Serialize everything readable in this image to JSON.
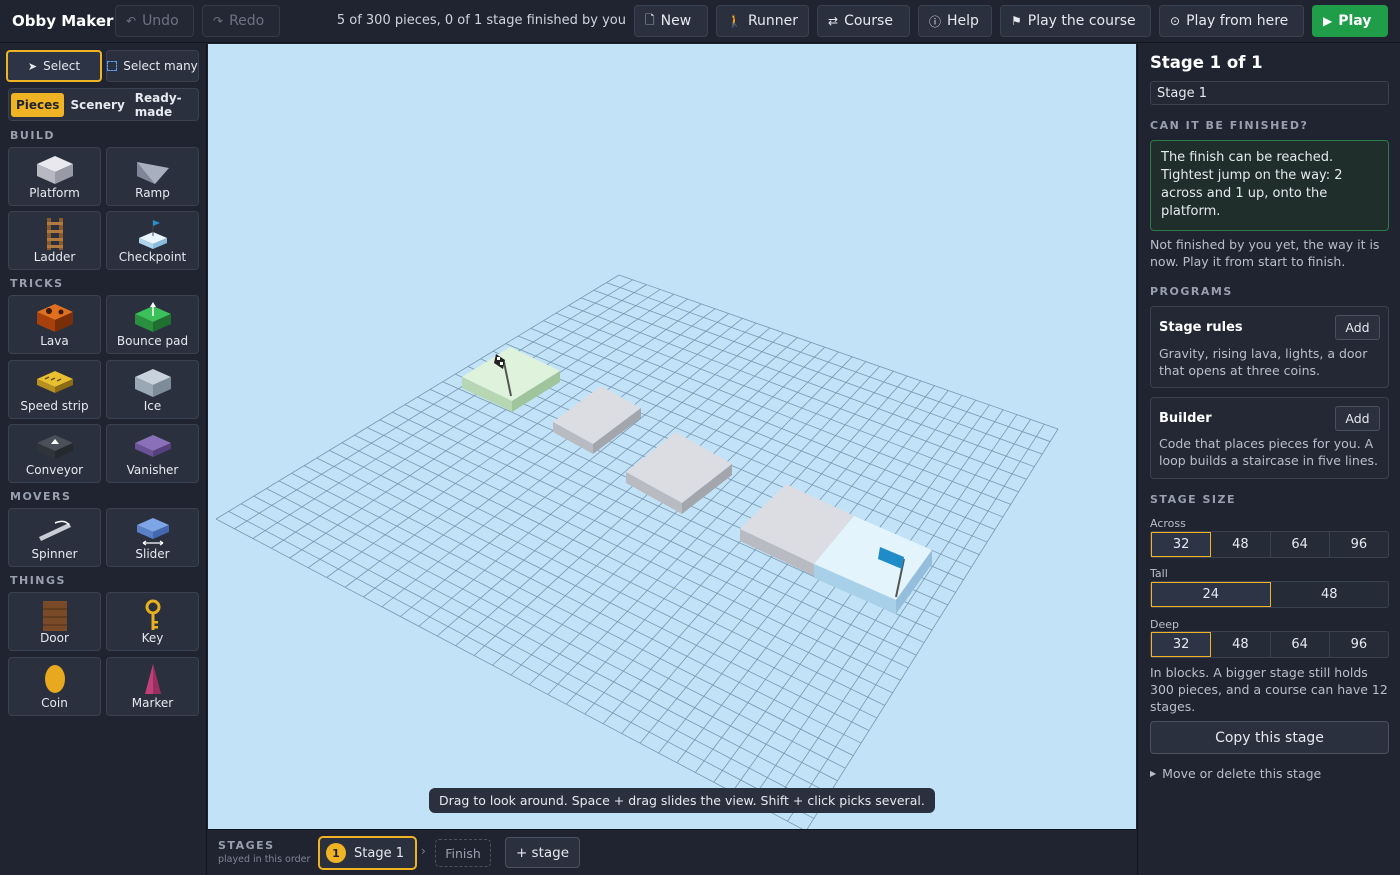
{
  "app": {
    "title": "Obby Maker"
  },
  "topbar": {
    "undo": "Undo",
    "redo": "Redo",
    "status": "5 of 300 pieces, 0 of 1 stage finished by you",
    "new": "New",
    "runner": "Runner",
    "course": "Course",
    "help": "Help",
    "play_course": "Play the course",
    "play_here": "Play from here",
    "play": "Play"
  },
  "left": {
    "select": "Select",
    "select_many": "Select many",
    "tabs": [
      "Pieces",
      "Scenery",
      "Ready-made"
    ],
    "sections": {
      "build": "BUILD",
      "tricks": "TRICKS",
      "movers": "MOVERS",
      "things": "THINGS"
    },
    "pieces": [
      "Platform",
      "Ramp",
      "Ladder",
      "Checkpoint",
      "Lava",
      "Bounce pad",
      "Speed strip",
      "Ice",
      "Conveyor",
      "Vanisher",
      "Spinner",
      "Slider",
      "Door",
      "Key",
      "Coin",
      "Marker"
    ]
  },
  "viewport": {
    "hint": "Drag to look around. Space + drag slides the view. Shift + click picks several."
  },
  "stages_bar": {
    "title": "STAGES",
    "subtitle": "played in this order",
    "stage_num": "1",
    "stage_label": "Stage 1",
    "finish": "Finish",
    "add": "+ stage"
  },
  "right": {
    "heading": "Stage 1 of 1",
    "name_value": "Stage 1",
    "finish_heading": "CAN IT BE FINISHED?",
    "finish_box": "The finish can be reached. Tightest jump on the way: 2 across and 1 up, onto the platform.",
    "finish_note": "Not finished by you yet, the way it is now. Play it from start to finish.",
    "programs_heading": "PROGRAMS",
    "rules_title": "Stage rules",
    "rules_desc": "Gravity, rising lava, lights, a door that opens at three coins.",
    "builder_title": "Builder",
    "builder_desc": "Code that places pieces for you. A loop builds a staircase in five lines.",
    "add": "Add",
    "size_heading": "STAGE SIZE",
    "across_label": "Across",
    "across": [
      "32",
      "48",
      "64",
      "96"
    ],
    "tall_label": "Tall",
    "tall": [
      "24",
      "48"
    ],
    "deep_label": "Deep",
    "deep": [
      "32",
      "48",
      "64",
      "96"
    ],
    "size_note": "In blocks. A bigger stage still holds 300 pieces, and a course can have 12 stages.",
    "copy": "Copy this stage",
    "move_delete": "Move or delete this stage"
  }
}
